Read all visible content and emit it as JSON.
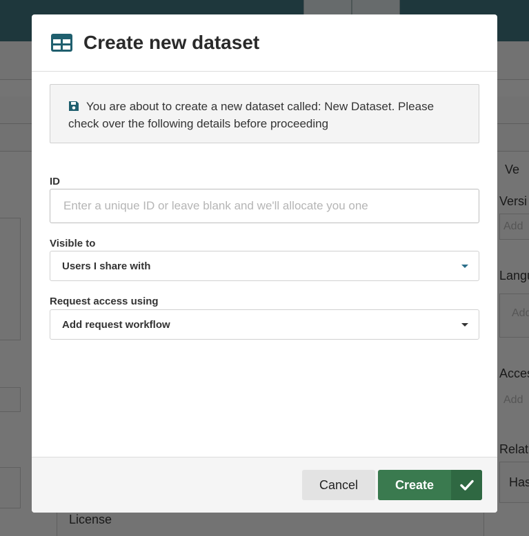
{
  "background": {
    "label_ve": "Ve",
    "label_versi": "Versi",
    "hint_add_1": "Add",
    "label_langu": "Langu",
    "hint_add_2": "Add",
    "label_acces": "Acces",
    "hint_add_3": "Add",
    "label_relat": "Relat",
    "label_has": "Has",
    "label_license": "License"
  },
  "modal": {
    "title": "Create new dataset",
    "title_icon": "table-icon",
    "notice": {
      "icon": "save-icon",
      "text": "You are about to create a new dataset called: New Dataset. Please check over the following details before proceeding"
    },
    "id_field": {
      "label": "ID",
      "value": "",
      "placeholder": "Enter a unique ID or leave blank and we'll allocate you one"
    },
    "visible_to": {
      "label": "Visible to",
      "selected": "Users I share with"
    },
    "request_access": {
      "label": "Request access using",
      "selected": "Add request workflow"
    },
    "footer": {
      "cancel_label": "Cancel",
      "create_label": "Create",
      "create_icon": "check-icon"
    }
  },
  "colors": {
    "brand_teal": "#1f5f6e",
    "create_green": "#3a7a4f"
  }
}
